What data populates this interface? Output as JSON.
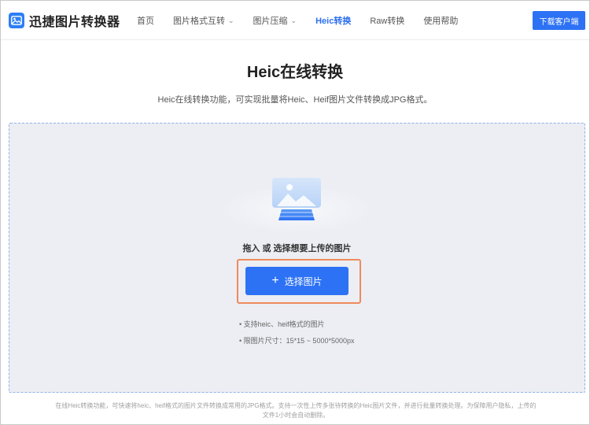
{
  "header": {
    "brand": "迅捷图片转换器",
    "nav": [
      {
        "label": "首页",
        "dropdown": false,
        "active": false
      },
      {
        "label": "图片格式互转",
        "dropdown": true,
        "active": false
      },
      {
        "label": "图片压缩",
        "dropdown": true,
        "active": false
      },
      {
        "label": "Heic转换",
        "dropdown": false,
        "active": true
      },
      {
        "label": "Raw转换",
        "dropdown": false,
        "active": false
      },
      {
        "label": "使用帮助",
        "dropdown": false,
        "active": false
      }
    ],
    "download_label": "下载客户端"
  },
  "hero": {
    "title": "Heic在线转换",
    "subtitle": "Heic在线转换功能，可实现批量将Heic、Heif图片文件转换成JPG格式。"
  },
  "upload": {
    "drop_text": "拖入 或 选择想要上传的图片",
    "select_label": "选择图片",
    "specs": [
      "• 支持heic、heif格式的图片",
      "• 限图片尺寸：15*15 ~ 5000*5000px"
    ]
  },
  "footer": {
    "line1": "在线Heic转换功能，可快速将heic、heif格式的图片文件转换成常用的JPG格式。支持一次性上传多张待转换的Heic图片文件，并进行批量转换处理。为保障用户隐私，上传的",
    "line2": "文件1小时会自动删除。"
  },
  "colors": {
    "accent": "#2d72f5",
    "highlight": "#f08a5d",
    "dropzone_bg": "#eceef3"
  }
}
